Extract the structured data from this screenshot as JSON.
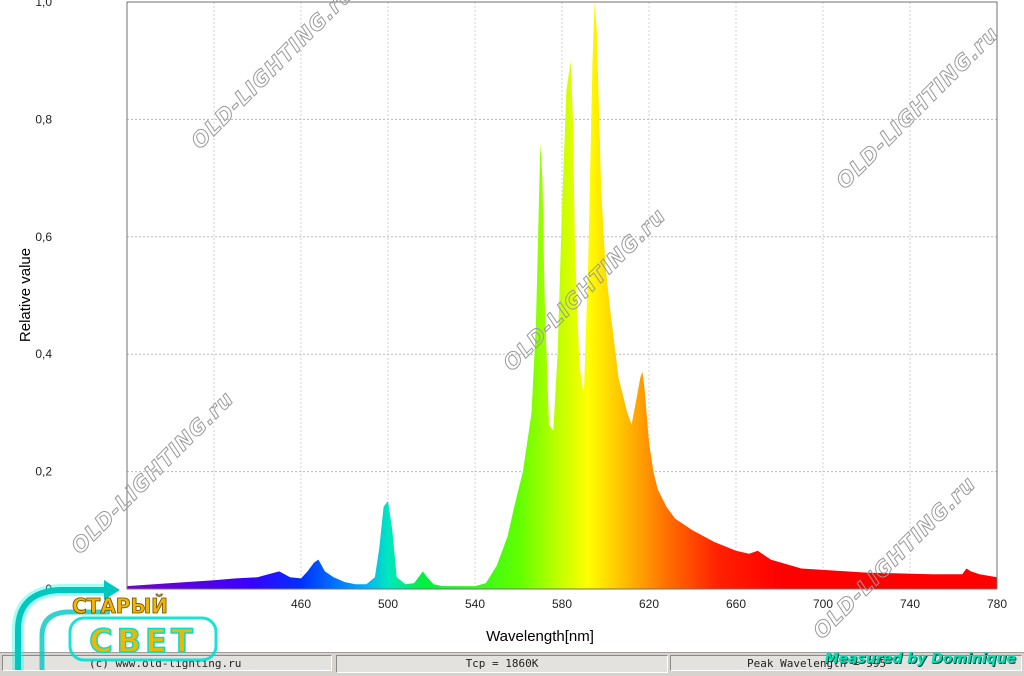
{
  "chart_data": {
    "type": "area",
    "xlabel": "Wavelength[nm]",
    "ylabel": "Relative value",
    "xlim": [
      380,
      780
    ],
    "ylim": [
      0,
      1.0
    ],
    "x_ticks": [
      {
        "value": 460,
        "label": "460"
      },
      {
        "value": 500,
        "label": "500"
      },
      {
        "value": 540,
        "label": "540"
      },
      {
        "value": 580,
        "label": "580"
      },
      {
        "value": 620,
        "label": "620"
      },
      {
        "value": 660,
        "label": "660"
      },
      {
        "value": 700,
        "label": "700"
      },
      {
        "value": 740,
        "label": "740"
      },
      {
        "value": 780,
        "label": "780"
      }
    ],
    "y_ticks": [
      {
        "value": 0,
        "label": "0"
      },
      {
        "value": 0.2,
        "label": "0,2"
      },
      {
        "value": 0.4,
        "label": "0,4"
      },
      {
        "value": 0.6,
        "label": "0,6"
      },
      {
        "value": 0.8,
        "label": "0,8"
      },
      {
        "value": 1.0,
        "label": "1,0"
      }
    ],
    "grid": true,
    "fill": "spectral colors (violet to red by wavelength)",
    "x": [
      380,
      400,
      420,
      430,
      440,
      445,
      450,
      455,
      460,
      463,
      466,
      468,
      471,
      475,
      480,
      485,
      490,
      494,
      496,
      498,
      500,
      502,
      504,
      508,
      512,
      514,
      516,
      518,
      521,
      525,
      530,
      540,
      545,
      550,
      555,
      558,
      562,
      566,
      568,
      569,
      570,
      571,
      572,
      574,
      576,
      578,
      580,
      582,
      584,
      585,
      586,
      588,
      590,
      592,
      594,
      595,
      596,
      598,
      600,
      602,
      604,
      606,
      608,
      610,
      612,
      614,
      616,
      617,
      618,
      620,
      622,
      624,
      628,
      632,
      640,
      650,
      660,
      666,
      670,
      676,
      690,
      720,
      750,
      764,
      766,
      768,
      772,
      780
    ],
    "y": [
      0.005,
      0.01,
      0.015,
      0.018,
      0.02,
      0.025,
      0.03,
      0.02,
      0.018,
      0.03,
      0.045,
      0.05,
      0.03,
      0.02,
      0.012,
      0.008,
      0.008,
      0.02,
      0.07,
      0.14,
      0.15,
      0.1,
      0.02,
      0.008,
      0.01,
      0.02,
      0.03,
      0.02,
      0.008,
      0.005,
      0.005,
      0.005,
      0.01,
      0.04,
      0.09,
      0.14,
      0.2,
      0.3,
      0.45,
      0.6,
      0.76,
      0.7,
      0.5,
      0.28,
      0.27,
      0.4,
      0.65,
      0.85,
      0.9,
      0.8,
      0.58,
      0.38,
      0.33,
      0.55,
      0.9,
      1.0,
      0.95,
      0.68,
      0.55,
      0.48,
      0.42,
      0.36,
      0.33,
      0.3,
      0.28,
      0.32,
      0.36,
      0.37,
      0.34,
      0.25,
      0.2,
      0.17,
      0.14,
      0.12,
      0.1,
      0.08,
      0.065,
      0.06,
      0.065,
      0.05,
      0.035,
      0.028,
      0.025,
      0.025,
      0.035,
      0.03,
      0.025,
      0.02
    ]
  },
  "watermarks": [
    "OLD-LIGHTING.ru",
    "OLD-LIGHTING.ru",
    "OLD-LIGHTING.ru",
    "OLD-LIGHTING.ru",
    "OLD-LIGHTING.ru",
    "OLD-LIGHTING.ru"
  ],
  "statusbar": {
    "copyright": "(c) www.old-lighting.ru",
    "tcp": "Tcp = 1860K",
    "peak": "Peak Wavelength = 595"
  },
  "credit": "Measured by Dominique",
  "logo": {
    "line1": "СТАРЫЙ",
    "line2": "СВЕТ"
  },
  "colors": {
    "grid": "#b8b8b8",
    "credit": "#00e0b0",
    "logo_text": "#f2b600",
    "logo_glow": "#00e0d0"
  }
}
